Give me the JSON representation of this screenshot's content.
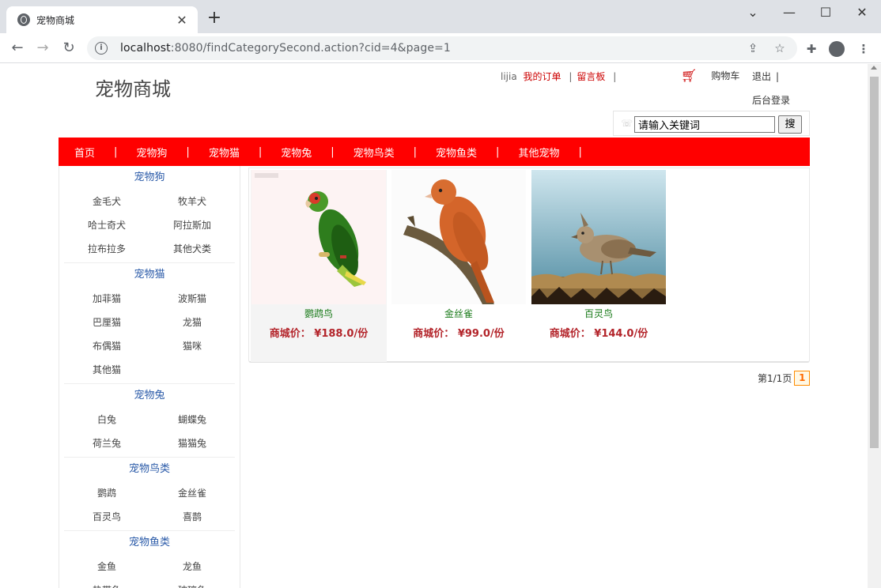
{
  "browser": {
    "tab_title": "宠物商城",
    "url_host": "localhost",
    "url_rest": ":8080/findCategorySecond.action?cid=4&page=1"
  },
  "site": {
    "logo": "宠物商城",
    "user": "lijia",
    "my_orders": "我的订单",
    "message_board": "留言板",
    "cart": "购物车",
    "logout": "退出",
    "admin_login": "后台登录",
    "search_placeholder": "请输入关键词",
    "search_button": "搜"
  },
  "nav": [
    "首页",
    "宠物狗",
    "宠物猫",
    "宠物兔",
    "宠物鸟类",
    "宠物鱼类",
    "其他宠物"
  ],
  "sidebar": [
    {
      "title": "宠物狗",
      "items": [
        "金毛犬",
        "牧羊犬",
        "哈士奇犬",
        "阿拉斯加",
        "拉布拉多",
        "其他犬类"
      ]
    },
    {
      "title": "宠物猫",
      "items": [
        "加菲猫",
        "波斯猫",
        "巴厘猫",
        "龙猫",
        "布偶猫",
        "猫咪",
        "其他猫"
      ]
    },
    {
      "title": "宠物兔",
      "items": [
        "白兔",
        "蝴蝶兔",
        "荷兰兔",
        "猫猫兔"
      ]
    },
    {
      "title": "宠物鸟类",
      "items": [
        "鹦鹉",
        "金丝雀",
        "百灵鸟",
        "喜鹊"
      ]
    },
    {
      "title": "宠物鱼类",
      "items": [
        "金鱼",
        "龙鱼",
        "热带鱼",
        "玻璃鱼"
      ]
    }
  ],
  "products": [
    {
      "name": "鹦鹉鸟",
      "price": "商城价： ¥188.0/份",
      "image_icon": "parrot-image"
    },
    {
      "name": "金丝雀",
      "price": "商城价： ¥99.0/份",
      "image_icon": "canary-image"
    },
    {
      "name": "百灵鸟",
      "price": "商城价： ¥144.0/份",
      "image_icon": "lark-image"
    }
  ],
  "pager": {
    "text": "第1/1页",
    "current": "1"
  }
}
